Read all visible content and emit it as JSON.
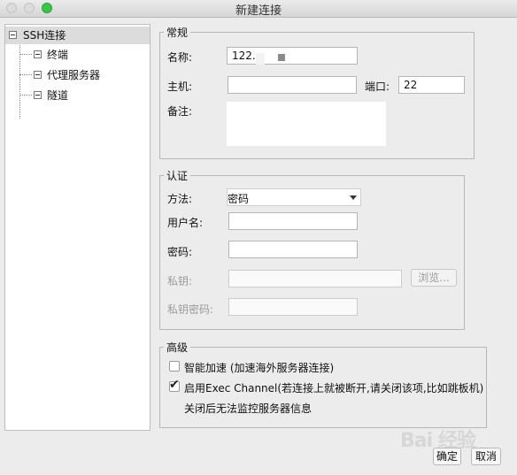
{
  "window": {
    "title": "新建连接"
  },
  "tree": {
    "root": "SSH连接",
    "children": [
      "终端",
      "代理服务器",
      "隧道"
    ]
  },
  "general": {
    "legend": "常规",
    "name_label": "名称:",
    "name_value": "122.",
    "host_label": "主机:",
    "host_value": "",
    "port_label": "端口:",
    "port_value": "22",
    "note_label": "备注:"
  },
  "auth": {
    "legend": "认证",
    "method_label": "方法:",
    "method_value": "密码",
    "username_label": "用户名:",
    "password_label": "密码:",
    "private_key_label": "私钥:",
    "browse_label": "浏览...",
    "key_password_label": "私钥密码:"
  },
  "advanced": {
    "legend": "高级",
    "smart_accel_label": "智能加速 (加速海外服务器连接)",
    "smart_accel_checked": false,
    "exec_channel_label": "启用Exec Channel(若连接上就被断开,请关闭该项,比如跳板机)",
    "exec_channel_checked": true,
    "exec_channel_note": "关闭后无法监控服务器信息"
  },
  "footer": {
    "ok_label": "确定",
    "cancel_label": "取消"
  },
  "watermark": "Bai 经验"
}
